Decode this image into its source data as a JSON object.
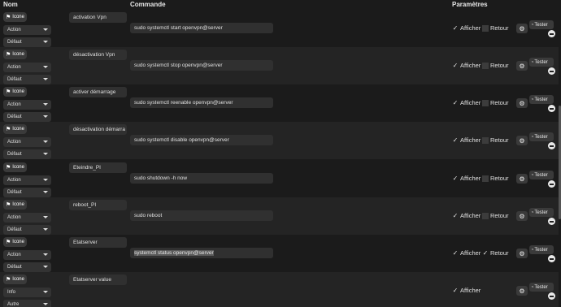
{
  "header": {
    "nom": "Nom",
    "commande": "Commande",
    "parametres": "Paramètres"
  },
  "common": {
    "icone_label": "Icone",
    "afficher_label": "Afficher",
    "retour_label": "Retour",
    "tester_label": "Tester",
    "flag_icon": "flag-icon",
    "gear_icon": "gear-icon",
    "rss_icon": "rss-icon",
    "check_glyph": "✓"
  },
  "rows": [
    {
      "name": "activation Vpn",
      "type": "Action",
      "subtype": "Défaut",
      "command": "sudo systemctl start openvpn@server",
      "afficher": true,
      "retour": false
    },
    {
      "name": "désactivation Vpn",
      "type": "Action",
      "subtype": "Défaut",
      "command": "sudo systemctl stop openvpn@server",
      "afficher": true,
      "retour": false
    },
    {
      "name": "activer démarrage",
      "type": "Action",
      "subtype": "Défaut",
      "command": "sudo systemctl reenable openvpn@server",
      "afficher": true,
      "retour": false
    },
    {
      "name": "désactivation démarra",
      "type": "Action",
      "subtype": "Défaut",
      "command": "sudo systemctl disable openvpn@server",
      "afficher": true,
      "retour": false
    },
    {
      "name": "Eteindre_PI",
      "type": "Action",
      "subtype": "Défaut",
      "command": "sudo shutdown -h now",
      "afficher": true,
      "retour": false
    },
    {
      "name": "reboot_PI",
      "type": "Action",
      "subtype": "Défaut",
      "command": "sudo reboot",
      "afficher": true,
      "retour": false
    },
    {
      "name": "Etatserver",
      "type": "Action",
      "subtype": "Défaut",
      "command": "systemctl status openvpn@server",
      "afficher": true,
      "retour": true
    },
    {
      "name": "Etatserver value",
      "type": "Info",
      "subtype": "Autre",
      "command": "",
      "afficher": true,
      "retour": null
    }
  ]
}
